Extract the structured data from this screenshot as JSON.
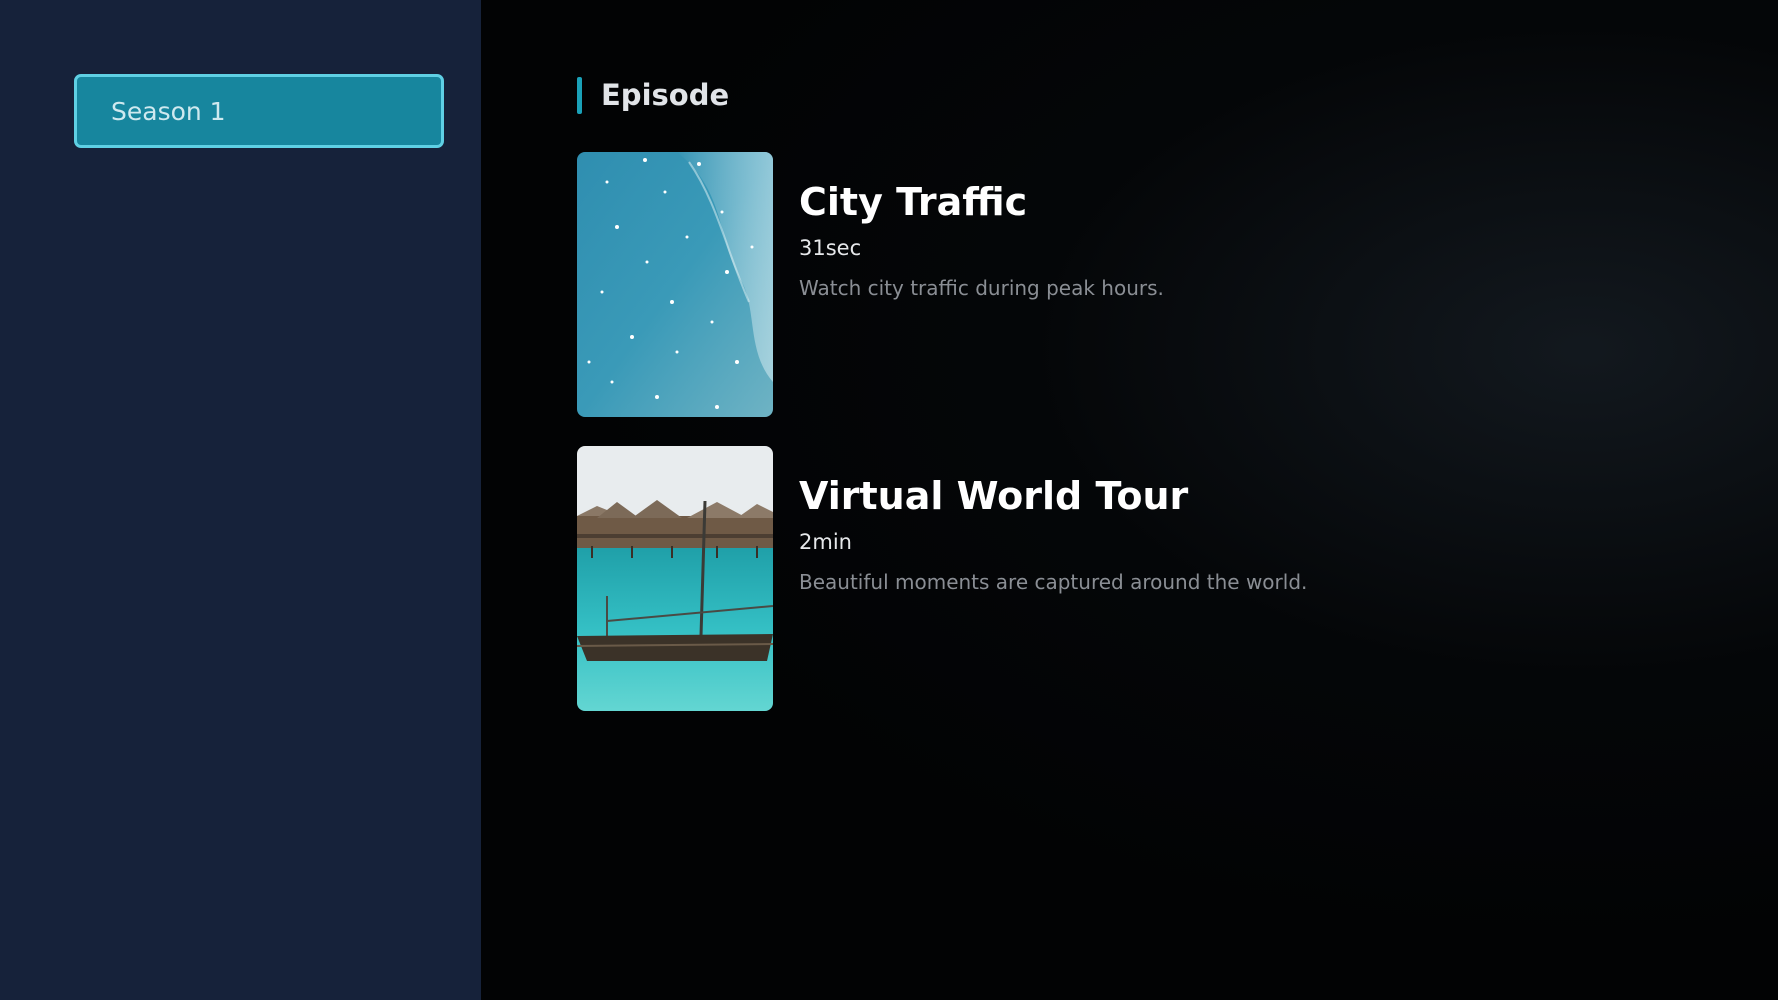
{
  "sidebar": {
    "season_button_label": "Season 1"
  },
  "main": {
    "section_title": "Episode",
    "episodes": [
      {
        "title": "City Traffic",
        "duration": "31sec",
        "description": "Watch city traffic during peak hours.",
        "thumbnail": "starry-sky-image"
      },
      {
        "title": "Virtual World Tour",
        "duration": "2min",
        "description": "Beautiful moments are captured around the world.",
        "thumbnail": "ocean-boat-huts-image"
      }
    ]
  },
  "colors": {
    "sidebar_bg": "#16223a",
    "accent": "#1aa1b8",
    "selected_border": "#5fd0e4",
    "main_bg": "#020304"
  }
}
